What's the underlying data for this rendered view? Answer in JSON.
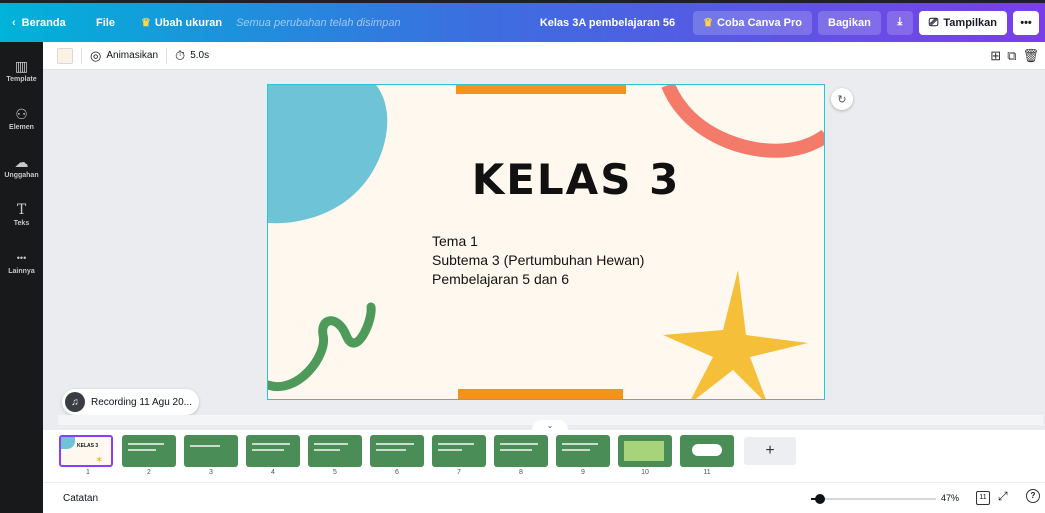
{
  "topbar": {
    "home_label": "Beranda",
    "file_label": "File",
    "resize_label": "Ubah ukuran",
    "saved_status": "Semua perubahan telah disimpan",
    "doc_name": "Kelas 3A pembelajaran 56",
    "pro_label": "Coba Canva Pro",
    "share_label": "Bagikan",
    "present_label": "Tampilkan",
    "more_label": "•••",
    "download_icon": "download-icon"
  },
  "sidebar": {
    "items": [
      {
        "label": "Template",
        "icon": "▥"
      },
      {
        "label": "Elemen",
        "icon": "⚇"
      },
      {
        "label": "Unggahan",
        "icon": "☁"
      },
      {
        "label": "Teks",
        "icon": "T"
      },
      {
        "label": "Lainnya",
        "icon": "•••"
      }
    ]
  },
  "editbar": {
    "animate_label": "Animasikan",
    "duration_label": "5.0s",
    "background_color": "#fbf1e4"
  },
  "slide": {
    "title": "KELAS 3",
    "lines": [
      "Tema 1",
      "Subtema 3 (Pertumbuhan Hewan)",
      "Pembelajaran 5 dan 6"
    ],
    "colors": {
      "background": "#fff8ee",
      "blue_blob": "#6fc3d6",
      "orange_arc": "#f47a6a",
      "orange_bar": "#f5921e",
      "green_squiggle": "#4d9a5b",
      "yellow_star": "#f6bf3a"
    }
  },
  "recording": {
    "label": "Recording 11 Agu 20..."
  },
  "thumbnails": {
    "pages": [
      "1",
      "2",
      "3",
      "4",
      "5",
      "6",
      "7",
      "8",
      "9",
      "10",
      "11"
    ],
    "thumb_title": "KELAS 3",
    "add_label": "+"
  },
  "footer": {
    "notes_label": "Catatan",
    "zoom_label": "47%",
    "zoom_fraction": 0.07,
    "page_count": "11",
    "help_label": "?"
  }
}
